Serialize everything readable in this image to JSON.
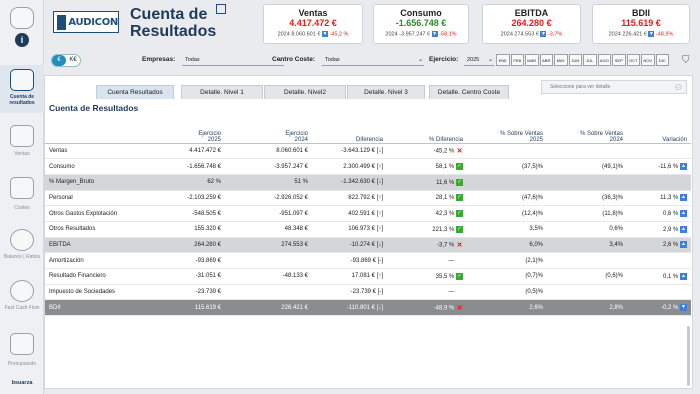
{
  "sidebar": {
    "items": [
      {
        "label": "",
        "icon": "home-icon"
      },
      {
        "label": "",
        "icon": "info-icon"
      },
      {
        "label": "Cuenta de resultados",
        "icon": "report-search-icon"
      },
      {
        "label": "Ventas",
        "icon": "sales-icon"
      },
      {
        "label": "Costes",
        "icon": "costs-icon"
      },
      {
        "label": "Balance | Ratios",
        "icon": "balance-icon"
      },
      {
        "label": "Fast Cash Flow",
        "icon": "piggybank-icon"
      },
      {
        "label": "Presupuesto",
        "icon": "calculator-icon"
      }
    ],
    "brand": "bsuarza"
  },
  "header": {
    "logo_text": "AUDICON",
    "title": "Cuenta de Resultados",
    "kpis": [
      {
        "title": "Ventas",
        "value": "4.417.472 €",
        "sub_prev": "2024 8.060.601 €",
        "pct": "-45,2 %",
        "value_color": "red"
      },
      {
        "title": "Consumo",
        "value": "-1.656.748 €",
        "sub_prev": "2024 -3.957.247 €",
        "pct": "-58,1%",
        "value_color": "green"
      },
      {
        "title": "EBITDA",
        "value": "264.280 €",
        "sub_prev": "2024 274.553 €",
        "pct": "-3,7%",
        "value_color": "red"
      },
      {
        "title": "BDII",
        "value": "115.619 €",
        "sub_prev": "2024 226.421 €",
        "pct": "-48,9%",
        "value_color": "red"
      }
    ]
  },
  "filters": {
    "currency_on": "€",
    "currency_off": "K€",
    "empresas_label": "Empresas:",
    "empresas_value": "Todas",
    "coste_label": "Centro Coste:",
    "coste_value": "Todas",
    "ejercicio_label": "Ejercicio:",
    "ejercicio_value": "2025",
    "months": [
      "ENE",
      "FEB",
      "MAR",
      "ABR",
      "MAY",
      "JUN",
      "JUL",
      "AGO",
      "SEP",
      "OCT",
      "NOV",
      "DIC"
    ]
  },
  "tabs": [
    "Cuenta Resultados",
    "Detalle. Nivel 1",
    "Detalle. Nivel2",
    "Detalle. Nivel 3",
    "Detalle. Centro Coste"
  ],
  "search_placeholder": "Seleccione para ver detalle",
  "section_title": "Cuenta de Resultados",
  "table": {
    "headers": [
      [
        "",
        ""
      ],
      [
        "Ejercicio",
        "2025"
      ],
      [
        "Ejercicio",
        "2024"
      ],
      [
        "Diferencia",
        ""
      ],
      [
        "% Diferencia",
        ""
      ],
      [
        "% Sobre Ventas",
        "2025"
      ],
      [
        "% Sobre Ventas",
        "2024"
      ],
      [
        "Variación",
        ""
      ]
    ],
    "rows": [
      {
        "style": "",
        "c": [
          "Ventas",
          "4.417.472 €",
          "8.060.601 €",
          "-3.643.129 € [↓]",
          "-45,2 %",
          "",
          "",
          ""
        ],
        "status": "bad",
        "var": ""
      },
      {
        "style": "",
        "c": [
          "Consumo",
          "-1.656.748 €",
          "-3.957.247 €",
          "2.300.499 € [↑]",
          "58,1 %",
          "(37,5)%",
          "(49,1)%",
          "-11,6 %"
        ],
        "status": "ok",
        "var": "up"
      },
      {
        "style": "grey",
        "c": [
          "% Margen_Bruto",
          "62 %",
          "51 %",
          "-1.342.630 € [↓]",
          "11,6 %",
          "",
          "",
          ""
        ],
        "status": "ok",
        "var": ""
      },
      {
        "style": "",
        "c": [
          "Personal",
          "-2.103.259 €",
          "-2.926.052 €",
          "822.792 € [↑]",
          "28,1 %",
          "(47,6)%",
          "(36,3)%",
          "11,3 %"
        ],
        "status": "ok",
        "var": "up"
      },
      {
        "style": "",
        "c": [
          "Otros Gastos Explotación",
          "-548.505 €",
          "-951.097 €",
          "402.591 € [↑]",
          "42,3 %",
          "(12,4)%",
          "(11,8)%",
          "0,6 %"
        ],
        "status": "ok",
        "var": "up"
      },
      {
        "style": "",
        "c": [
          "Otros Resultados",
          "155.320 €",
          "48.348 €",
          "106.973 € [↑]",
          "221,3 %",
          "3,5%",
          "0,6%",
          "2,9 %"
        ],
        "status": "ok",
        "var": "up"
      },
      {
        "style": "grey",
        "c": [
          "EBITDA",
          "264.280 €",
          "274.553 €",
          "-10.274 € [↓]",
          "-3,7 %",
          "6,0%",
          "3,4%",
          "2,6 %"
        ],
        "status": "bad",
        "var": "up"
      },
      {
        "style": "",
        "c": [
          "Amortización",
          "-93.869 €",
          "",
          "-93.869 € [-]",
          "—",
          "(2,1)%",
          "",
          ""
        ],
        "status": "",
        "var": ""
      },
      {
        "style": "",
        "c": [
          "Resultado Financiero",
          "-31.051 €",
          "-48.133 €",
          "17.081 € [↑]",
          "35,5 %",
          "(0,7)%",
          "(0,6)%",
          "0,1 %"
        ],
        "status": "ok",
        "var": "up"
      },
      {
        "style": "",
        "c": [
          "Impuesto de Sociedades",
          "-23.739 €",
          "",
          "-23.739 € [-]",
          "—",
          "(0,5)%",
          "",
          ""
        ],
        "status": "",
        "var": ""
      },
      {
        "style": "dark",
        "c": [
          "BDII",
          "115.619 €",
          "226.421 €",
          "-110.801 € [↓]",
          "-48,9 %",
          "2,6%",
          "2,8%",
          "-0,2 %"
        ],
        "status": "bad",
        "var": "down"
      }
    ]
  }
}
